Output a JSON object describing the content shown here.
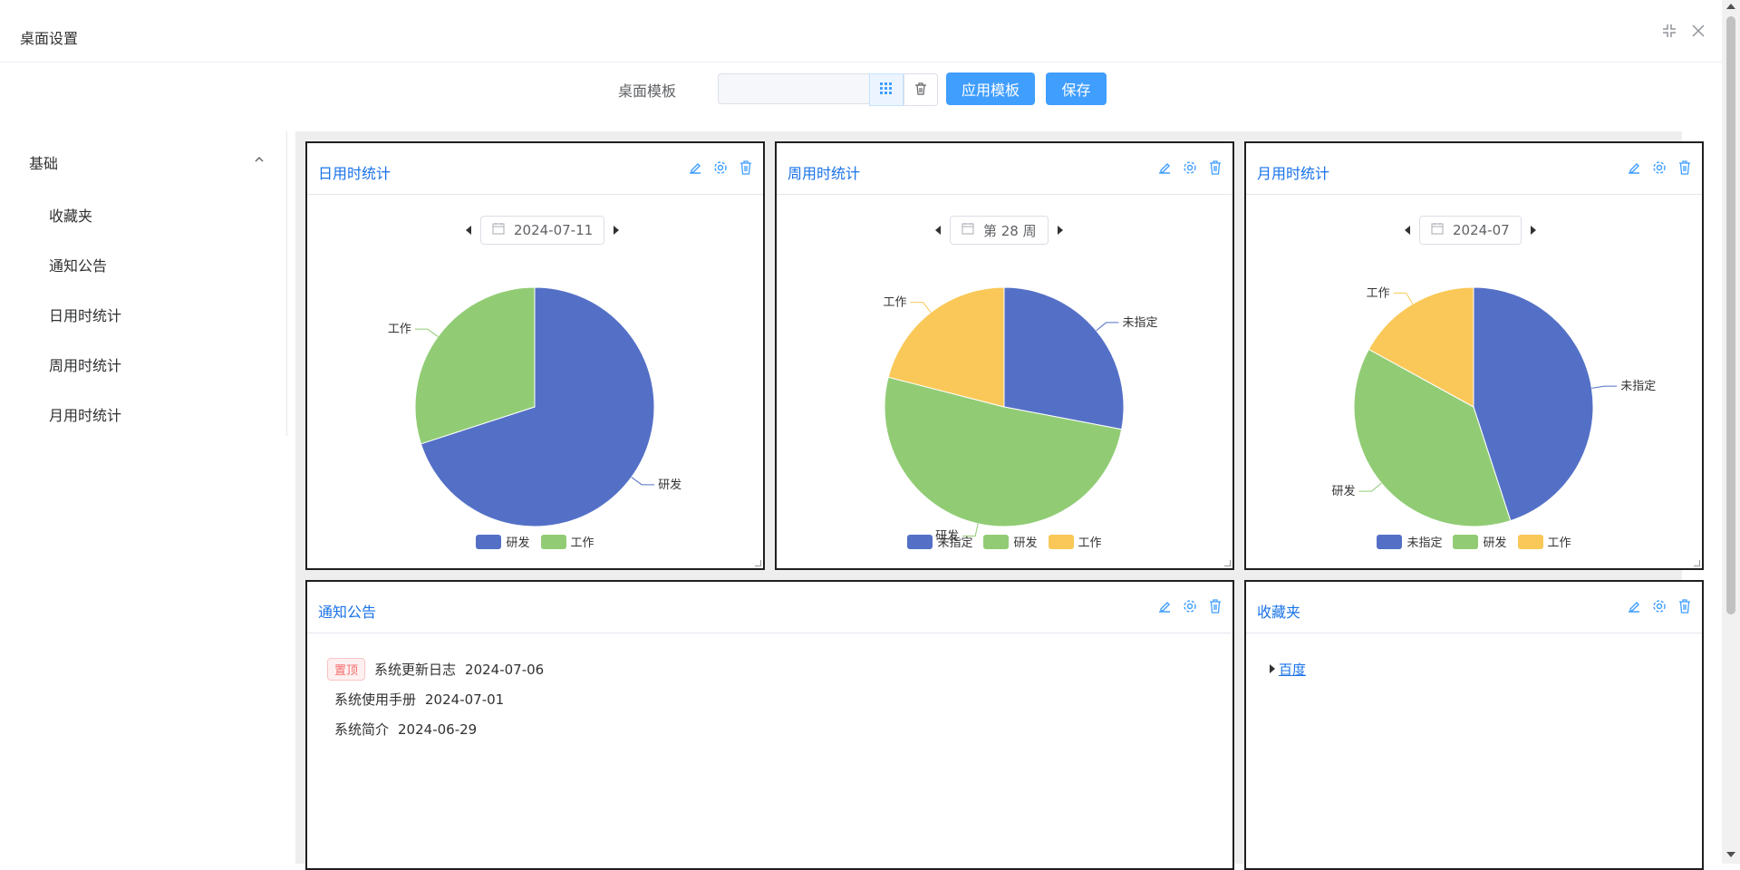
{
  "header": {
    "title": "桌面设置"
  },
  "toolbar": {
    "template_label": "桌面模板",
    "template_input_value": "",
    "apply_label": "应用模板",
    "save_label": "保存"
  },
  "sidebar": {
    "group_label": "基础",
    "items": [
      {
        "label": "收藏夹"
      },
      {
        "label": "通知公告"
      },
      {
        "label": "日用时统计"
      },
      {
        "label": "周用时统计"
      },
      {
        "label": "月用时统计"
      }
    ]
  },
  "colors": {
    "accent": "#409eff",
    "title_blue": "#1a73e8",
    "pie_blue": "#5470c6",
    "pie_green": "#91cc75",
    "pie_yellow": "#fac858"
  },
  "cards": {
    "daily": {
      "title": "日用时统计",
      "date": "2024-07-11"
    },
    "weekly": {
      "title": "周用时统计",
      "date": "第 28 周"
    },
    "monthly": {
      "title": "月用时统计",
      "date": "2024-07"
    },
    "notice": {
      "title": "通知公告",
      "items": [
        {
          "tag": "置顶",
          "title": "系统更新日志",
          "date": "2024-07-06"
        },
        {
          "tag": "",
          "title": "系统使用手册",
          "date": "2024-07-01"
        },
        {
          "tag": "",
          "title": "系统简介",
          "date": "2024-06-29"
        }
      ]
    },
    "favorites": {
      "title": "收藏夹",
      "links": [
        {
          "label": "百度"
        }
      ]
    }
  },
  "chart_data": [
    {
      "type": "pie",
      "title": "",
      "legend": "bottom",
      "slices": [
        {
          "name": "研发",
          "value": 70,
          "color": "#5470c6"
        },
        {
          "name": "工作",
          "value": 30,
          "color": "#91cc75"
        }
      ]
    },
    {
      "type": "pie",
      "title": "",
      "legend": "bottom",
      "slices": [
        {
          "name": "未指定",
          "value": 28,
          "color": "#5470c6"
        },
        {
          "name": "研发",
          "value": 51,
          "color": "#91cc75"
        },
        {
          "name": "工作",
          "value": 21,
          "color": "#fac858"
        }
      ]
    },
    {
      "type": "pie",
      "title": "",
      "legend": "bottom",
      "slices": [
        {
          "name": "未指定",
          "value": 45,
          "color": "#5470c6"
        },
        {
          "name": "研发",
          "value": 38,
          "color": "#91cc75"
        },
        {
          "name": "工作",
          "value": 17,
          "color": "#fac858"
        }
      ]
    }
  ]
}
